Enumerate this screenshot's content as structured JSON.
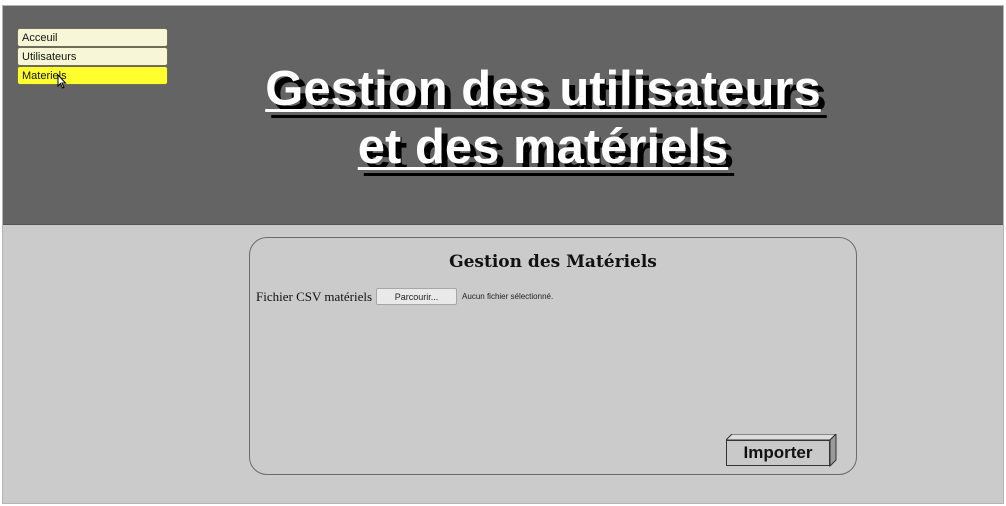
{
  "nav": {
    "items": [
      {
        "label": "Acceuil",
        "active": false
      },
      {
        "label": "Utilisateurs",
        "active": false
      },
      {
        "label": "Materiels",
        "active": true
      }
    ]
  },
  "header": {
    "title_line1": "Gestion des utilisateurs",
    "title_line2": "et des matériels"
  },
  "panel": {
    "title": "Gestion des Matériels",
    "file_label": "Fichier CSV matériels",
    "browse_label": "Parcourir...",
    "no_file_text": "Aucun fichier sélectionné.",
    "import_label": "Importer"
  },
  "colors": {
    "header_bg": "#646464",
    "page_bg": "#cbcbcb",
    "nav_bg": "#f7f7d7",
    "nav_active_bg": "#ffff2e"
  }
}
